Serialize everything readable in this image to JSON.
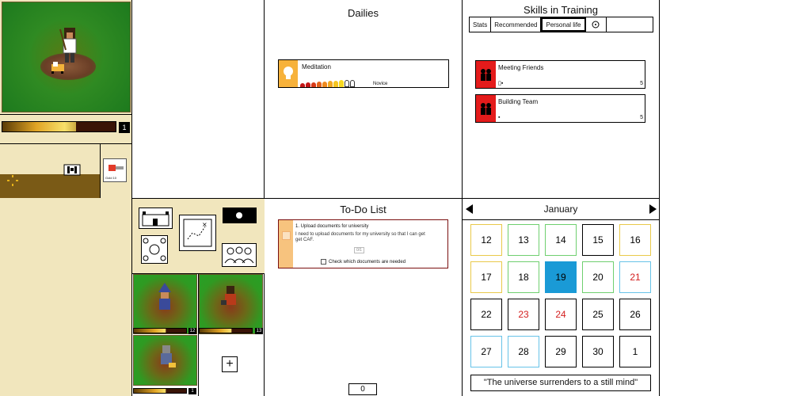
{
  "hero": {
    "level": "1"
  },
  "inventory": {
    "item_label": "Gold 10"
  },
  "dailies": {
    "title": "Dailies",
    "items": [
      {
        "name": "Meditation",
        "rank": "Novice"
      }
    ]
  },
  "skills": {
    "title": "Skills in Training",
    "tabs": [
      "Stats",
      "Recommended",
      "Personal life"
    ],
    "active_tab": "Personal life",
    "items": [
      {
        "name": "Meeting Friends",
        "count": "5"
      },
      {
        "name": "Building Team",
        "count": "5"
      }
    ]
  },
  "todo": {
    "title": "To-Do List",
    "items": [
      {
        "title": "1. Upload documents for university",
        "description": "I need to upload documents for my university so that I can get get CAF.",
        "badge": "0/1",
        "checklist": "Check which documents are needed"
      }
    ],
    "counter": "0"
  },
  "calendar": {
    "month": "January",
    "days": [
      {
        "n": "12",
        "color": "#000",
        "border": "#e9c94a"
      },
      {
        "n": "13",
        "color": "#000",
        "border": "#6fcf6f"
      },
      {
        "n": "14",
        "color": "#000",
        "border": "#6fcf6f"
      },
      {
        "n": "15",
        "color": "#000",
        "border": "#000"
      },
      {
        "n": "16",
        "color": "#000",
        "border": "#e9c94a"
      },
      {
        "n": "17",
        "color": "#000",
        "border": "#e9c94a"
      },
      {
        "n": "18",
        "color": "#000",
        "border": "#6fcf6f"
      },
      {
        "n": "19",
        "color": "#000",
        "border": "#1a9ad6",
        "fill": "#1a9ad6"
      },
      {
        "n": "20",
        "color": "#000",
        "border": "#6fcf6f"
      },
      {
        "n": "21",
        "color": "#d42020",
        "border": "#67c3e8"
      },
      {
        "n": "22",
        "color": "#000",
        "border": "#000"
      },
      {
        "n": "23",
        "color": "#d42020",
        "border": "#000"
      },
      {
        "n": "24",
        "color": "#d42020",
        "border": "#000"
      },
      {
        "n": "25",
        "color": "#000",
        "border": "#000"
      },
      {
        "n": "26",
        "color": "#000",
        "border": "#000"
      },
      {
        "n": "27",
        "color": "#000",
        "border": "#67c3e8"
      },
      {
        "n": "28",
        "color": "#000",
        "border": "#67c3e8"
      },
      {
        "n": "29",
        "color": "#000",
        "border": "#000"
      },
      {
        "n": "30",
        "color": "#000",
        "border": "#000"
      },
      {
        "n": "1",
        "color": "#000",
        "border": "#000"
      }
    ],
    "quote": "\"The universe surrenders to a still mind\""
  },
  "pets": [
    {
      "level": "12"
    },
    {
      "level": "13"
    },
    {
      "level": "1"
    }
  ],
  "colors": {
    "accent": "#1a9ad6",
    "skill_red": "#e41b1b",
    "daily_orange": "#f7b23b",
    "panel_beige": "#f1e6bd"
  }
}
